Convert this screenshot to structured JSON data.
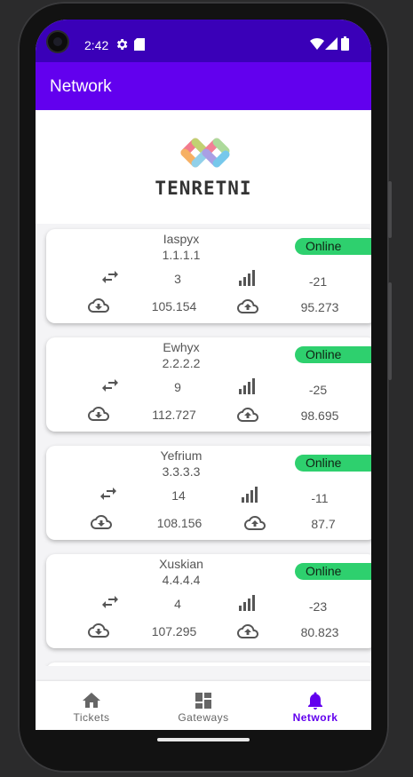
{
  "status_bar": {
    "time": "2:42"
  },
  "app_bar": {
    "title": "Network"
  },
  "brand": {
    "logo_text": "TENRETNI"
  },
  "colors": {
    "app_bar": "#6200ee",
    "status_bar": "#3a00b8",
    "online": "#2ed06e",
    "active_tab": "#6200ee"
  },
  "gateways": [
    {
      "name": "Iaspyx",
      "ip": "1.1.1.1",
      "status": "Online",
      "connections": "3",
      "signal": "-21",
      "download": "105.154",
      "upload": "95.273"
    },
    {
      "name": "Ewhyx",
      "ip": "2.2.2.2",
      "status": "Online",
      "connections": "9",
      "signal": "-25",
      "download": "112.727",
      "upload": "98.695"
    },
    {
      "name": "Yefrium",
      "ip": "3.3.3.3",
      "status": "Online",
      "connections": "14",
      "signal": "-11",
      "download": "108.156",
      "upload": "87.7"
    },
    {
      "name": "Xuskian",
      "ip": "4.4.4.4",
      "status": "Online",
      "connections": "4",
      "signal": "-23",
      "download": "107.295",
      "upload": "80.823"
    }
  ],
  "bottom_nav": {
    "tabs": [
      {
        "label": "Tickets",
        "icon": "home-icon"
      },
      {
        "label": "Gateways",
        "icon": "dashboard-icon"
      },
      {
        "label": "Network",
        "icon": "bell-icon"
      }
    ],
    "active": "Network"
  }
}
